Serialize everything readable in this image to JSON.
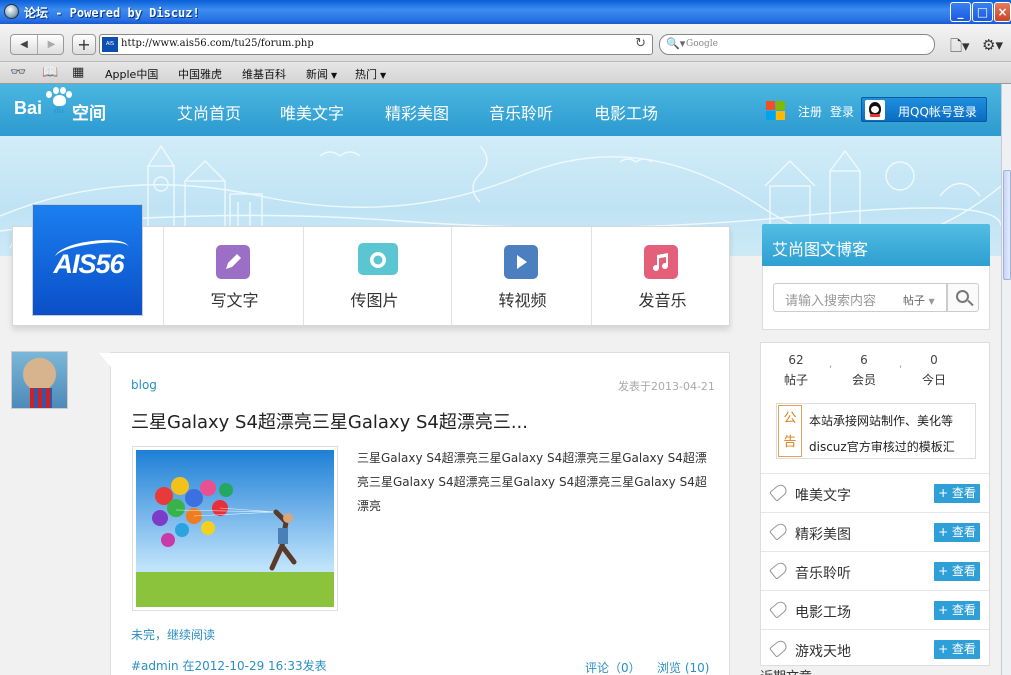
{
  "window": {
    "title": "论坛 - Powered by Discuz!"
  },
  "browser": {
    "url": "http://www.ais56.com/tu25/forum.php",
    "search_placeholder": "Google",
    "bookmarks": [
      {
        "label": "Apple中国",
        "has_menu": false
      },
      {
        "label": "中国雅虎",
        "has_menu": false
      },
      {
        "label": "维基百科",
        "has_menu": false
      },
      {
        "label": "新闻",
        "has_menu": true
      },
      {
        "label": "热门",
        "has_menu": true
      }
    ]
  },
  "site": {
    "logo": {
      "brand": "Bai",
      "du": "du",
      "zone": "空间"
    },
    "nav": [
      "艾尚首页",
      "唯美文字",
      "精彩美图",
      "音乐聆听",
      "电影工场"
    ],
    "register": "注册",
    "login": "登录",
    "qq_login": "用QQ帐号登录"
  },
  "publish": {
    "logo_text": "AIS56",
    "items": [
      {
        "label": "写文字",
        "icon": "pencil-icon",
        "color": "#9b6fc6"
      },
      {
        "label": "传图片",
        "icon": "camera-icon",
        "color": "#5ac6d2"
      },
      {
        "label": "转视频",
        "icon": "play-icon",
        "color": "#4b7fbf"
      },
      {
        "label": "发音乐",
        "icon": "music-note-icon",
        "color": "#e35f7a"
      }
    ]
  },
  "sidebar": {
    "title": "艾尚图文博客",
    "search_placeholder": "请输入搜索内容",
    "search_scope": "帖子",
    "stats": [
      {
        "value": "62",
        "label": "帖子"
      },
      {
        "value": "6",
        "label": "会员"
      },
      {
        "value": "0",
        "label": "今日"
      }
    ],
    "notice": {
      "tag": "公告",
      "lines": [
        "本站承接网站制作、美化等",
        "discuz官方审核过的模板汇"
      ]
    },
    "categories": [
      {
        "name": "唯美文字",
        "button": "+ 查看"
      },
      {
        "name": "精彩美图",
        "button": "+ 查看"
      },
      {
        "name": "音乐聆听",
        "button": "+ 查看"
      },
      {
        "name": "电影工场",
        "button": "+ 查看"
      },
      {
        "name": "游戏天地",
        "button": "+ 查看"
      }
    ],
    "next_section": "近期文章"
  },
  "post": {
    "category": "blog",
    "date": "发表于2013-04-21",
    "title": "三星Galaxy S4超漂亮三星Galaxy S4超漂亮三...",
    "excerpt": "三星Galaxy S4超漂亮三星Galaxy S4超漂亮三星Galaxy S4超漂亮三星Galaxy S4超漂亮三星Galaxy S4超漂亮三星Galaxy S4超漂亮",
    "read_more": "未完，继续阅读",
    "meta": "#admin 在2012-10-29 16:33发表",
    "comments": "评论（0）",
    "views": "浏览 (10)"
  }
}
